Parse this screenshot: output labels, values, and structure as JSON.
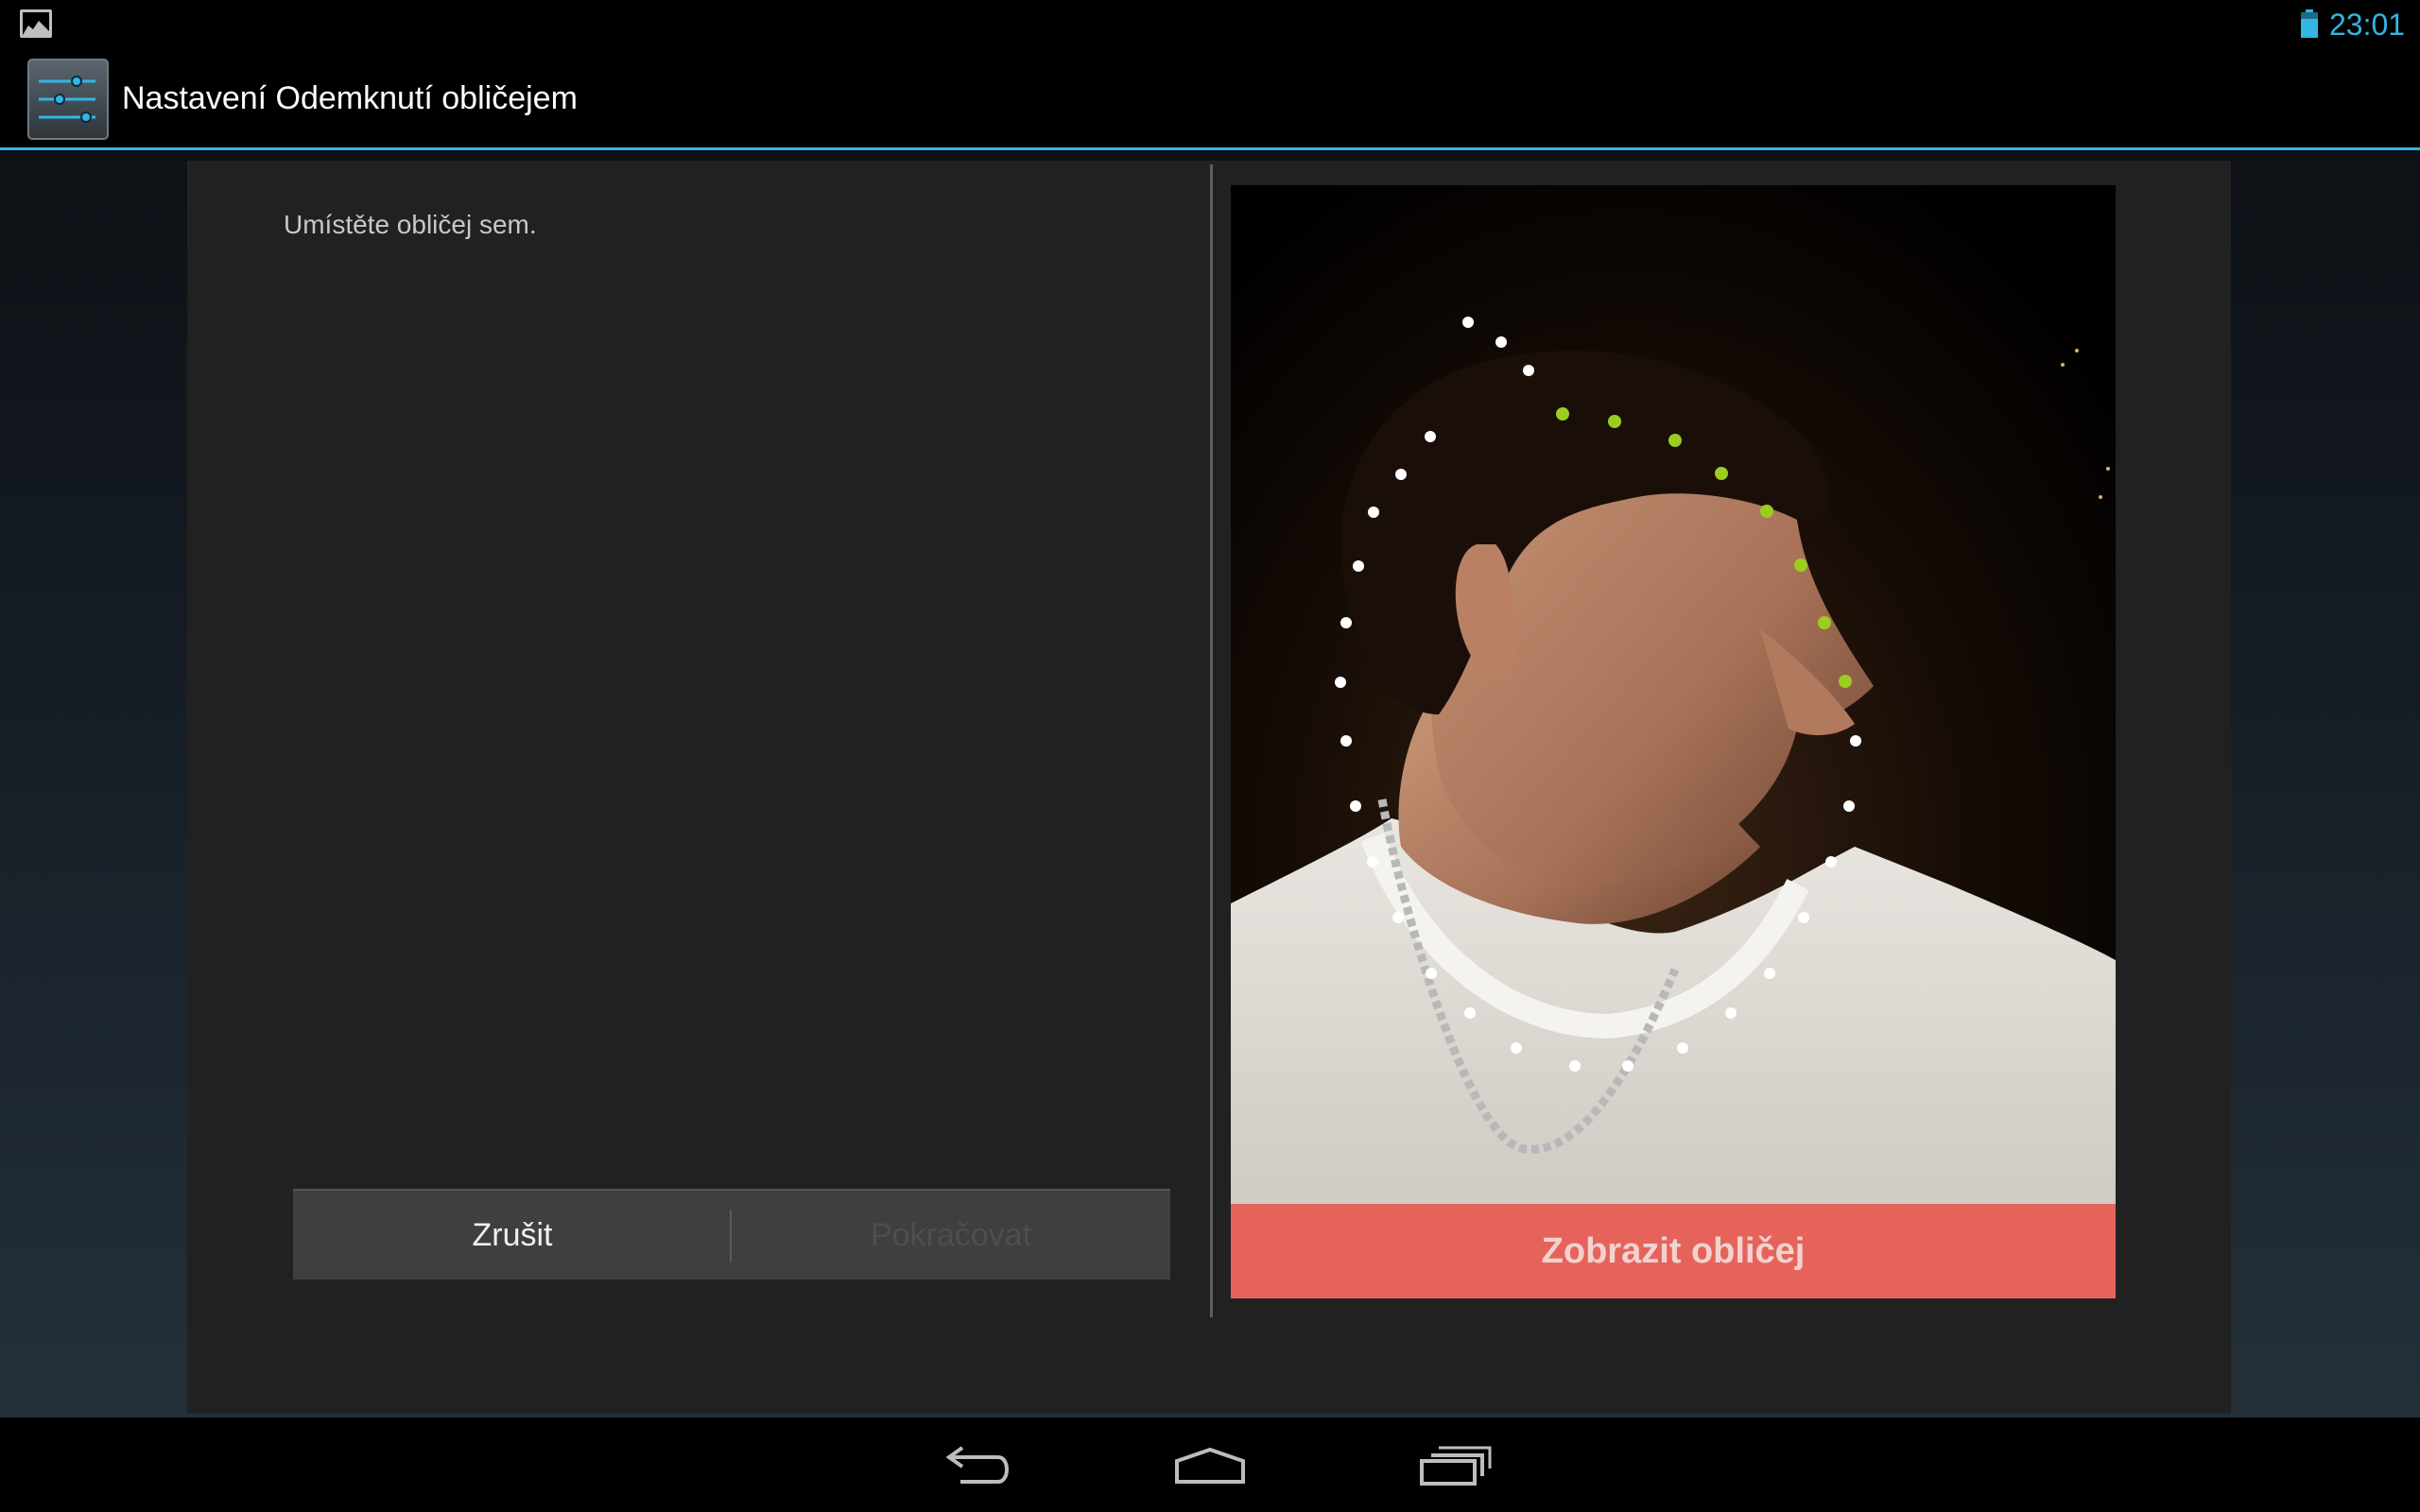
{
  "status_bar": {
    "time": "23:01",
    "notification_icon": "image-icon",
    "battery_icon": "battery-icon",
    "accent_color": "#33b5e5"
  },
  "action_bar": {
    "title": "Nastavení Odemknutí obličejem",
    "app_icon": "settings-sliders-icon"
  },
  "dialog": {
    "instruction": "Umístěte obličej sem.",
    "cancel_label": "Zrušit",
    "continue_label": "Pokračovat",
    "continue_enabled": false
  },
  "camera": {
    "show_face_label": "Zobrazit obličej",
    "overlay_color": "#e85a52",
    "progress_dot_color": "#9acd1e",
    "dot_color": "#ffffff"
  },
  "nav_bar": {
    "back_icon": "back-icon",
    "home_icon": "home-icon",
    "recent_icon": "recent-apps-icon"
  }
}
